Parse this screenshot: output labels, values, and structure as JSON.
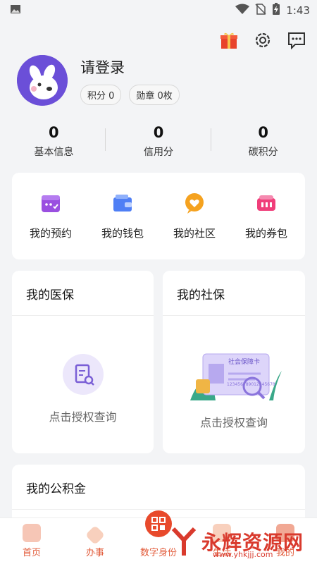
{
  "status_bar": {
    "time": "1:43",
    "icons": [
      "picture-icon",
      "wifi-icon",
      "no-sim-icon",
      "battery-charging-icon"
    ]
  },
  "top_actions": {
    "icons": [
      "gift-icon",
      "gear-icon",
      "message-icon"
    ]
  },
  "profile": {
    "login_text": "请登录",
    "points_label": "积分 0",
    "badges_label": "勋章 0枚"
  },
  "stats": [
    {
      "value": "0",
      "label": "基本信息"
    },
    {
      "value": "0",
      "label": "信用分"
    },
    {
      "value": "0",
      "label": "碳积分"
    }
  ],
  "quick_actions": [
    {
      "label": "我的预约",
      "icon": "calendar-icon",
      "color": "#9a4fe0"
    },
    {
      "label": "我的钱包",
      "icon": "wallet-icon",
      "color": "#4f7ff5"
    },
    {
      "label": "我的社区",
      "icon": "community-icon",
      "color": "#f5a21f"
    },
    {
      "label": "我的券包",
      "icon": "coupon-icon",
      "color": "#f03e7a"
    }
  ],
  "medical": {
    "title": "我的医保",
    "action_text": "点击授权查询",
    "icon": "document-search-icon"
  },
  "social": {
    "title": "我的社保",
    "action_text": "点击授权查询",
    "card_label": "社会保障卡",
    "card_number": "123456789012345678"
  },
  "provident": {
    "title": "我的公积金"
  },
  "bottom_nav": [
    {
      "label": "首页",
      "icon": "home-icon"
    },
    {
      "label": "办事",
      "icon": "service-icon"
    },
    {
      "label": "数字身份",
      "icon": "id-icon"
    },
    {
      "label": "生活",
      "icon": "life-icon"
    },
    {
      "label": "我的",
      "icon": "profile-icon"
    }
  ],
  "watermark": {
    "title": "永辉资源网",
    "url": "www.yhkjjj.com"
  },
  "colors": {
    "accent": "#e84a2c",
    "avatar_bg": "#6b4fd8",
    "background": "#f3f4f6"
  }
}
